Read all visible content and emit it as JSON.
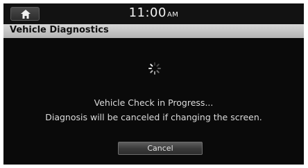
{
  "status_bar": {
    "home_icon": "home-icon",
    "time": "11:00",
    "am_pm": "AM"
  },
  "header": {
    "title": "Vehicle Diagnostics"
  },
  "main": {
    "spinner_icon": "loading-spinner-icon",
    "message_line1": "Vehicle Check in Progress...",
    "message_line2": "Diagnosis will be canceled if changing the screen.",
    "cancel_label": "Cancel"
  },
  "colors": {
    "background": "#0a0a0a",
    "title_bar": "#c4c4c4",
    "text": "#dcdcdc"
  }
}
